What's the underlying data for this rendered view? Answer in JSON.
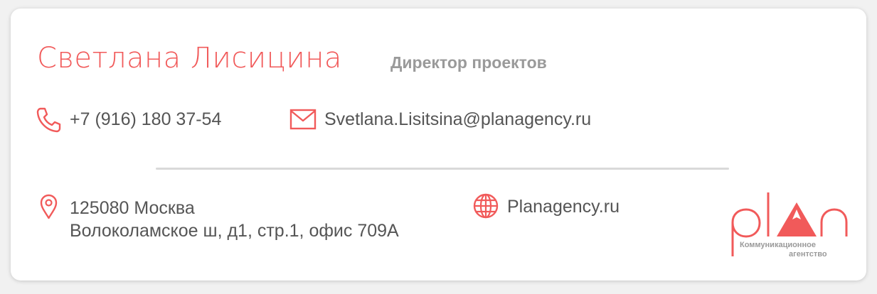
{
  "card": {
    "name": "Светлана Лисицина",
    "role": "Директор проектов",
    "phone": "+7 (916) 180 37-54",
    "email": "Svetlana.Lisitsina@planagency.ru",
    "address_line1": "125080 Москва",
    "address_line2": "Волоколамское ш, д1, стр.1, офис 709А",
    "website": "Planagency.ru"
  },
  "logo": {
    "wordmark": "plan",
    "subtitle_line1": "Коммуникационное",
    "subtitle_line2": "агентство"
  },
  "colors": {
    "accent": "#f15a5a",
    "text": "#555555",
    "muted": "#9a9a9a",
    "divider": "#d9d9d9"
  },
  "icons": {
    "phone": "phone-icon",
    "email": "envelope-icon",
    "address": "map-pin-icon",
    "website": "globe-icon"
  }
}
